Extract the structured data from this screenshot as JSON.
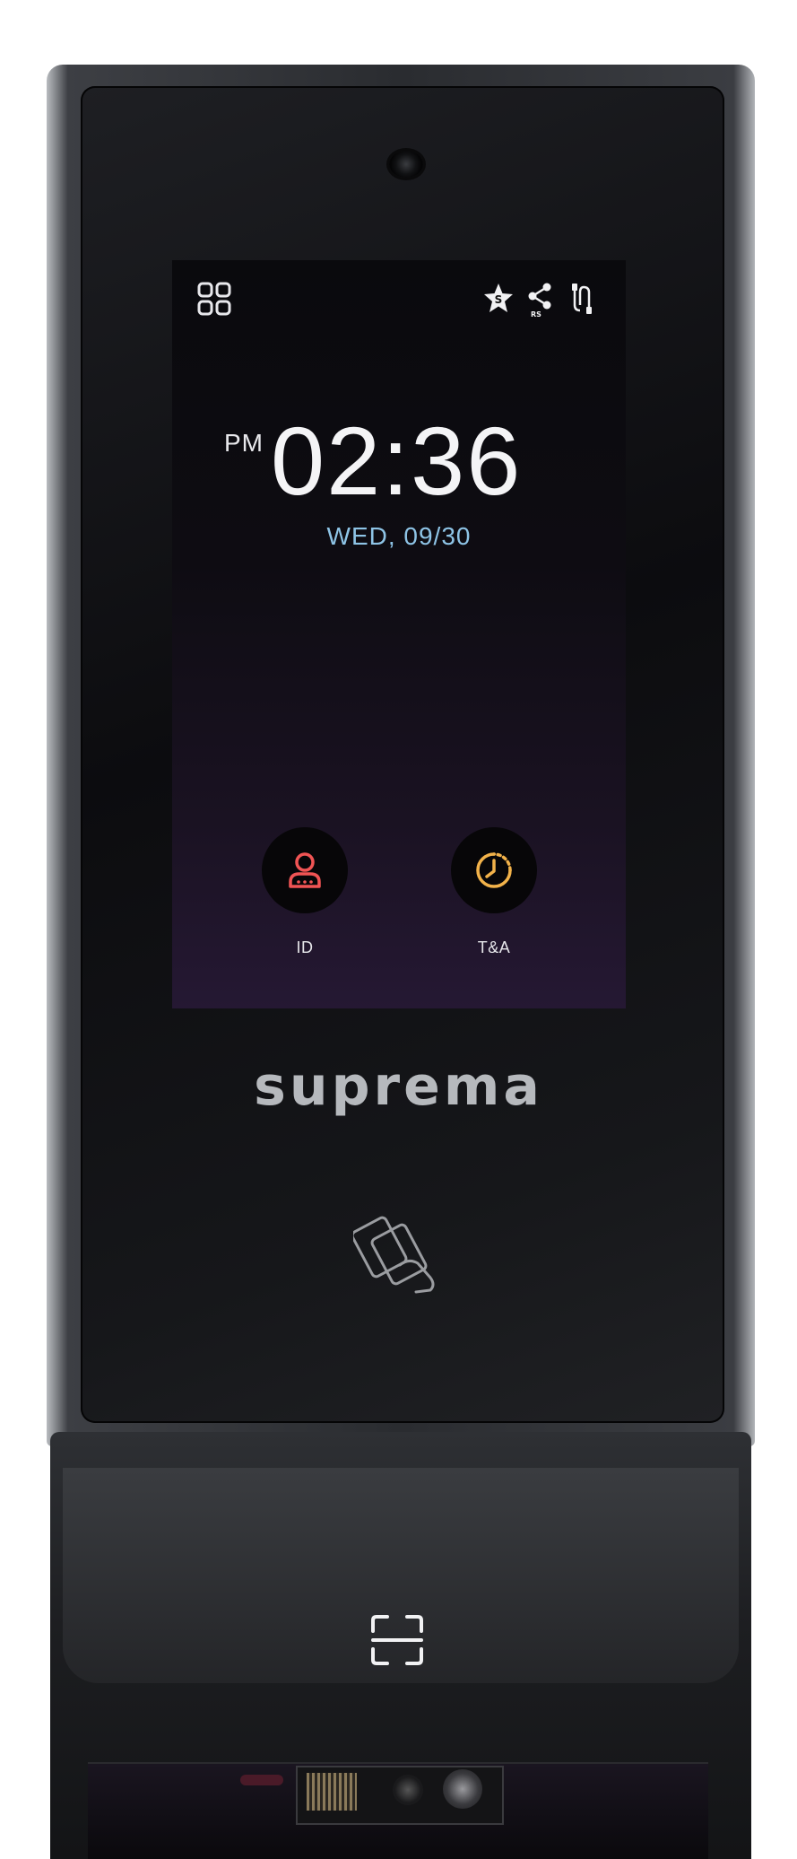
{
  "device": {
    "brand": "suprema"
  },
  "status_bar": {
    "icons": [
      "grid-menu-icon",
      "suprema-star-icon",
      "rs-share-icon",
      "usb-connection-icon"
    ],
    "share_badge": "RS",
    "star_badge": "S"
  },
  "clock": {
    "ampm": "PM",
    "time": "02:36",
    "date": "WED,  09/30"
  },
  "actions": [
    {
      "label": "ID",
      "icon": "user-id-icon",
      "color": "#f05454"
    },
    {
      "label": "T&A",
      "icon": "clock-icon",
      "color": "#f2b24a"
    }
  ],
  "colors": {
    "date_text": "#8ec4e6",
    "logo": "#b6b9bd"
  }
}
